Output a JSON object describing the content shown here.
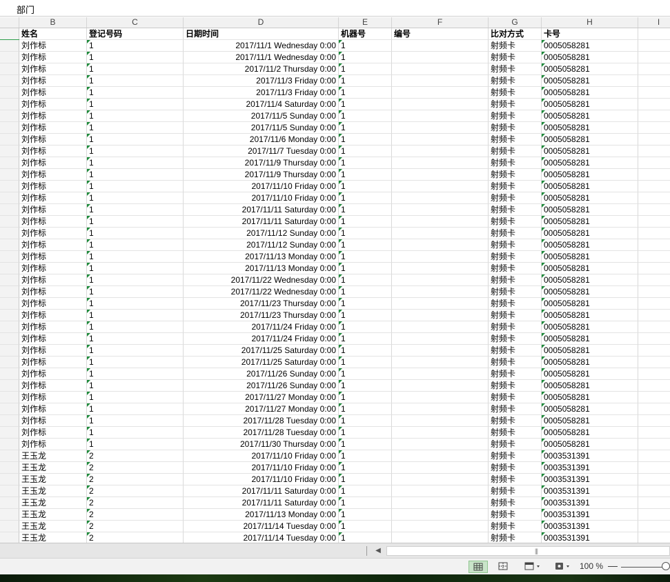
{
  "formula_bar": {
    "content": "部门"
  },
  "columns": [
    "B",
    "C",
    "D",
    "E",
    "F",
    "G",
    "H",
    "I"
  ],
  "headers": {
    "name": "姓名",
    "reg_no": "登记号码",
    "datetime": "日期时间",
    "machine": "机器号",
    "code": "编号",
    "match_mode": "比对方式",
    "card_no": "卡号"
  },
  "rows": [
    {
      "name": "刘作标",
      "reg": "1",
      "dt": "2017/11/1 Wednesday 0:00",
      "machine": "1",
      "code": "",
      "mode": "射频卡",
      "card": "0005058281"
    },
    {
      "name": "刘作标",
      "reg": "1",
      "dt": "2017/11/1 Wednesday 0:00",
      "machine": "1",
      "code": "",
      "mode": "射频卡",
      "card": "0005058281"
    },
    {
      "name": "刘作标",
      "reg": "1",
      "dt": "2017/11/2 Thursday 0:00",
      "machine": "1",
      "code": "",
      "mode": "射频卡",
      "card": "0005058281"
    },
    {
      "name": "刘作标",
      "reg": "1",
      "dt": "2017/11/3 Friday 0:00",
      "machine": "1",
      "code": "",
      "mode": "射频卡",
      "card": "0005058281"
    },
    {
      "name": "刘作标",
      "reg": "1",
      "dt": "2017/11/3 Friday 0:00",
      "machine": "1",
      "code": "",
      "mode": "射频卡",
      "card": "0005058281"
    },
    {
      "name": "刘作标",
      "reg": "1",
      "dt": "2017/11/4 Saturday 0:00",
      "machine": "1",
      "code": "",
      "mode": "射频卡",
      "card": "0005058281"
    },
    {
      "name": "刘作标",
      "reg": "1",
      "dt": "2017/11/5 Sunday 0:00",
      "machine": "1",
      "code": "",
      "mode": "射频卡",
      "card": "0005058281"
    },
    {
      "name": "刘作标",
      "reg": "1",
      "dt": "2017/11/5 Sunday 0:00",
      "machine": "1",
      "code": "",
      "mode": "射频卡",
      "card": "0005058281"
    },
    {
      "name": "刘作标",
      "reg": "1",
      "dt": "2017/11/6 Monday 0:00",
      "machine": "1",
      "code": "",
      "mode": "射频卡",
      "card": "0005058281"
    },
    {
      "name": "刘作标",
      "reg": "1",
      "dt": "2017/11/7 Tuesday 0:00",
      "machine": "1",
      "code": "",
      "mode": "射频卡",
      "card": "0005058281"
    },
    {
      "name": "刘作标",
      "reg": "1",
      "dt": "2017/11/9 Thursday 0:00",
      "machine": "1",
      "code": "",
      "mode": "射频卡",
      "card": "0005058281"
    },
    {
      "name": "刘作标",
      "reg": "1",
      "dt": "2017/11/9 Thursday 0:00",
      "machine": "1",
      "code": "",
      "mode": "射频卡",
      "card": "0005058281"
    },
    {
      "name": "刘作标",
      "reg": "1",
      "dt": "2017/11/10 Friday 0:00",
      "machine": "1",
      "code": "",
      "mode": "射频卡",
      "card": "0005058281"
    },
    {
      "name": "刘作标",
      "reg": "1",
      "dt": "2017/11/10 Friday 0:00",
      "machine": "1",
      "code": "",
      "mode": "射频卡",
      "card": "0005058281"
    },
    {
      "name": "刘作标",
      "reg": "1",
      "dt": "2017/11/11 Saturday 0:00",
      "machine": "1",
      "code": "",
      "mode": "射频卡",
      "card": "0005058281"
    },
    {
      "name": "刘作标",
      "reg": "1",
      "dt": "2017/11/11 Saturday 0:00",
      "machine": "1",
      "code": "",
      "mode": "射频卡",
      "card": "0005058281"
    },
    {
      "name": "刘作标",
      "reg": "1",
      "dt": "2017/11/12 Sunday 0:00",
      "machine": "1",
      "code": "",
      "mode": "射频卡",
      "card": "0005058281"
    },
    {
      "name": "刘作标",
      "reg": "1",
      "dt": "2017/11/12 Sunday 0:00",
      "machine": "1",
      "code": "",
      "mode": "射频卡",
      "card": "0005058281"
    },
    {
      "name": "刘作标",
      "reg": "1",
      "dt": "2017/11/13 Monday 0:00",
      "machine": "1",
      "code": "",
      "mode": "射频卡",
      "card": "0005058281"
    },
    {
      "name": "刘作标",
      "reg": "1",
      "dt": "2017/11/13 Monday 0:00",
      "machine": "1",
      "code": "",
      "mode": "射频卡",
      "card": "0005058281"
    },
    {
      "name": "刘作标",
      "reg": "1",
      "dt": "2017/11/22 Wednesday 0:00",
      "machine": "1",
      "code": "",
      "mode": "射频卡",
      "card": "0005058281"
    },
    {
      "name": "刘作标",
      "reg": "1",
      "dt": "2017/11/22 Wednesday 0:00",
      "machine": "1",
      "code": "",
      "mode": "射频卡",
      "card": "0005058281"
    },
    {
      "name": "刘作标",
      "reg": "1",
      "dt": "2017/11/23 Thursday 0:00",
      "machine": "1",
      "code": "",
      "mode": "射频卡",
      "card": "0005058281"
    },
    {
      "name": "刘作标",
      "reg": "1",
      "dt": "2017/11/23 Thursday 0:00",
      "machine": "1",
      "code": "",
      "mode": "射频卡",
      "card": "0005058281"
    },
    {
      "name": "刘作标",
      "reg": "1",
      "dt": "2017/11/24 Friday 0:00",
      "machine": "1",
      "code": "",
      "mode": "射频卡",
      "card": "0005058281"
    },
    {
      "name": "刘作标",
      "reg": "1",
      "dt": "2017/11/24 Friday 0:00",
      "machine": "1",
      "code": "",
      "mode": "射频卡",
      "card": "0005058281"
    },
    {
      "name": "刘作标",
      "reg": "1",
      "dt": "2017/11/25 Saturday 0:00",
      "machine": "1",
      "code": "",
      "mode": "射频卡",
      "card": "0005058281"
    },
    {
      "name": "刘作标",
      "reg": "1",
      "dt": "2017/11/25 Saturday 0:00",
      "machine": "1",
      "code": "",
      "mode": "射频卡",
      "card": "0005058281"
    },
    {
      "name": "刘作标",
      "reg": "1",
      "dt": "2017/11/26 Sunday 0:00",
      "machine": "1",
      "code": "",
      "mode": "射频卡",
      "card": "0005058281"
    },
    {
      "name": "刘作标",
      "reg": "1",
      "dt": "2017/11/26 Sunday 0:00",
      "machine": "1",
      "code": "",
      "mode": "射频卡",
      "card": "0005058281"
    },
    {
      "name": "刘作标",
      "reg": "1",
      "dt": "2017/11/27 Monday 0:00",
      "machine": "1",
      "code": "",
      "mode": "射频卡",
      "card": "0005058281"
    },
    {
      "name": "刘作标",
      "reg": "1",
      "dt": "2017/11/27 Monday 0:00",
      "machine": "1",
      "code": "",
      "mode": "射频卡",
      "card": "0005058281"
    },
    {
      "name": "刘作标",
      "reg": "1",
      "dt": "2017/11/28 Tuesday 0:00",
      "machine": "1",
      "code": "",
      "mode": "射频卡",
      "card": "0005058281"
    },
    {
      "name": "刘作标",
      "reg": "1",
      "dt": "2017/11/28 Tuesday 0:00",
      "machine": "1",
      "code": "",
      "mode": "射频卡",
      "card": "0005058281"
    },
    {
      "name": "刘作标",
      "reg": "1",
      "dt": "2017/11/30 Thursday 0:00",
      "machine": "1",
      "code": "",
      "mode": "射频卡",
      "card": "0005058281"
    },
    {
      "name": "王玉龙",
      "reg": "2",
      "dt": "2017/11/10 Friday 0:00",
      "machine": "1",
      "code": "",
      "mode": "射频卡",
      "card": "0003531391"
    },
    {
      "name": "王玉龙",
      "reg": "2",
      "dt": "2017/11/10 Friday 0:00",
      "machine": "1",
      "code": "",
      "mode": "射频卡",
      "card": "0003531391"
    },
    {
      "name": "王玉龙",
      "reg": "2",
      "dt": "2017/11/10 Friday 0:00",
      "machine": "1",
      "code": "",
      "mode": "射频卡",
      "card": "0003531391"
    },
    {
      "name": "王玉龙",
      "reg": "2",
      "dt": "2017/11/11 Saturday 0:00",
      "machine": "1",
      "code": "",
      "mode": "射频卡",
      "card": "0003531391"
    },
    {
      "name": "王玉龙",
      "reg": "2",
      "dt": "2017/11/11 Saturday 0:00",
      "machine": "1",
      "code": "",
      "mode": "射频卡",
      "card": "0003531391"
    },
    {
      "name": "王玉龙",
      "reg": "2",
      "dt": "2017/11/13 Monday 0:00",
      "machine": "1",
      "code": "",
      "mode": "射频卡",
      "card": "0003531391"
    },
    {
      "name": "王玉龙",
      "reg": "2",
      "dt": "2017/11/14 Tuesday 0:00",
      "machine": "1",
      "code": "",
      "mode": "射频卡",
      "card": "0003531391"
    },
    {
      "name": "王玉龙",
      "reg": "2",
      "dt": "2017/11/14 Tuesday 0:00",
      "machine": "1",
      "code": "",
      "mode": "射频卡",
      "card": "0003531391"
    }
  ],
  "status_bar": {
    "zoom": "100 %",
    "minus": "—"
  },
  "scrollbar": {
    "left_arrow": "◀",
    "grip": "|||"
  },
  "icons": [
    "normal-view-icon",
    "page-break-view-icon",
    "page-layout-icon",
    "eye-protection-icon",
    "zoom-slider"
  ],
  "colors": {
    "accent": "#2e9e4a",
    "comment_marker": "#1d8a3a",
    "status_active": "#c9e4c9"
  }
}
